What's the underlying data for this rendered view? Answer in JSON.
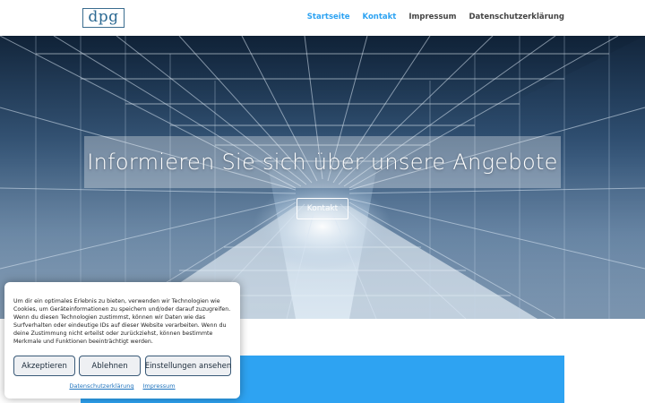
{
  "header": {
    "logo_text": "dpg",
    "nav": [
      {
        "label": "Startseite",
        "active": true
      },
      {
        "label": "Kontakt",
        "active": true
      },
      {
        "label": "Impressum",
        "active": false
      },
      {
        "label": "Datenschutzerklärung",
        "active": false
      }
    ]
  },
  "hero": {
    "title": "Informieren Sie sich über unsere Angebote",
    "button_label": "Kontakt"
  },
  "cookie_banner": {
    "text": "Um dir ein optimales Erlebnis zu bieten, verwenden wir Technologien wie Cookies, um Geräteinformationen zu speichern und/oder darauf zuzugreifen. Wenn du diesen Technologien zustimmst, können wir Daten wie das Surfverhalten oder eindeutige IDs auf dieser Website verarbeiten. Wenn du deine Zustimmung nicht erteilst oder zurückziehst, können bestimmte Merkmale und Funktionen beeinträchtigt werden.",
    "accept_label": "Akzeptieren",
    "deny_label": "Ablehnen",
    "settings_label": "Einstellungen ansehen",
    "privacy_link": "Datenschutzerklärung",
    "imprint_link": "Impressum"
  },
  "colors": {
    "accent": "#2ea3f2",
    "nav_text": "#444444",
    "logo": "#2d6a93"
  }
}
